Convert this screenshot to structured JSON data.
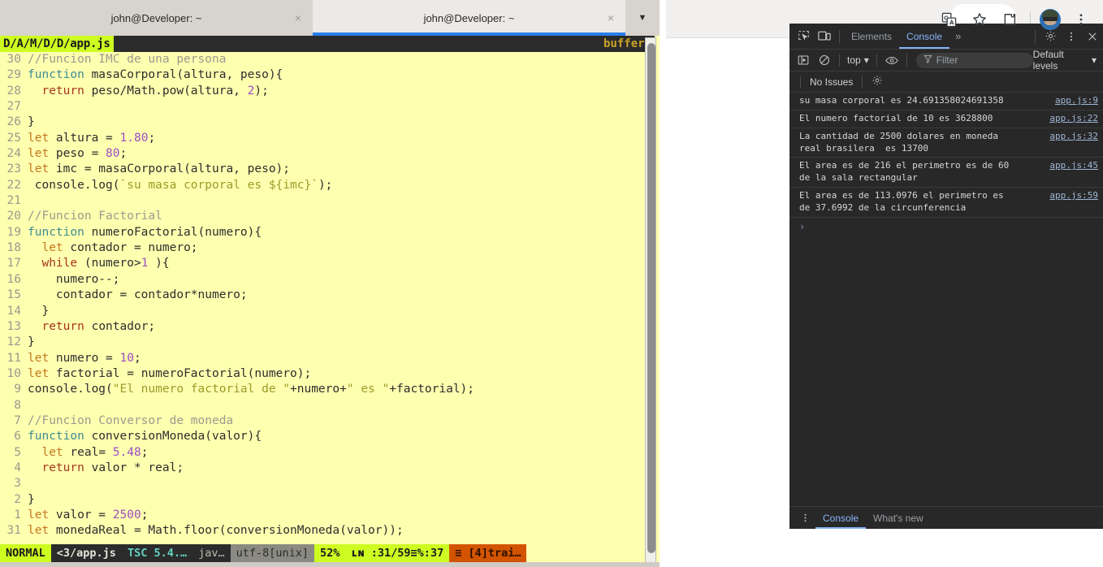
{
  "browser": {
    "toolbar": {
      "icons": [
        {
          "name": "translate-icon",
          "label": "Translate"
        },
        {
          "name": "bookmark-star-icon",
          "label": "Bookmark this tab"
        },
        {
          "name": "extensions-puzzle-icon",
          "label": "Extensions"
        },
        {
          "name": "profile-avatar",
          "label": "Profile"
        },
        {
          "name": "chrome-menu-kebab-icon",
          "label": "Customize and control Google Chrome"
        }
      ]
    }
  },
  "devtools": {
    "tabbar": {
      "inspect_icon": "inspect-element-icon",
      "device_icon": "device-toolbar-icon",
      "tabs": [
        {
          "label": "Elements",
          "active": false
        },
        {
          "label": "Console",
          "active": true
        }
      ],
      "more_label": "»",
      "settings_icon": "gear-icon",
      "kebab_icon": "more-options-icon",
      "close_icon": "close-icon"
    },
    "filterbar": {
      "sidebar_icon": "console-sidebar-icon",
      "clear_icon": "clear-console-icon",
      "context": "top",
      "eye_icon": "live-expression-eye-icon",
      "filter_icon": "filter-funnel-icon",
      "filter_placeholder": "Filter",
      "filter_value": "",
      "levels_label": "Default levels"
    },
    "issuebar": {
      "issues_label": "No Issues",
      "settings_icon": "console-settings-gear-icon"
    },
    "console_messages": [
      {
        "text": "su masa corporal es 24.691358024691358",
        "source": "app.js:9"
      },
      {
        "text": "El numero factorial de 10 es 3628800",
        "source": "app.js:22"
      },
      {
        "text": "La cantidad de 2500 dolares en moneda\nreal brasilera  es 13700",
        "source": "app.js:32"
      },
      {
        "text": "El area es de 216 el perimetro es de 60\nde la sala rectangular",
        "source": "app.js:45"
      },
      {
        "text": "El area es de 113.0976 el perimetro es\nde 37.6992 de la circunferencia",
        "source": "app.js:59"
      }
    ],
    "prompt_glyph": "›",
    "drawer": {
      "kebab_icon": "drawer-more-options-icon",
      "tabs": [
        {
          "label": "Console",
          "active": true
        },
        {
          "label": "What's new",
          "active": false
        }
      ]
    }
  },
  "terminal": {
    "tabs": [
      {
        "label": "john@Developer: ~",
        "active": false,
        "close_glyph": "×"
      },
      {
        "label": "john@Developer: ~",
        "active": true,
        "close_glyph": "×"
      }
    ],
    "tab_menu_glyph": "▼",
    "tmux": {
      "file_label": "D/A/M/D/D/app.js",
      "right_label": "buffers"
    },
    "code_lines": [
      {
        "num": "30",
        "tokens": [
          {
            "c": "k-cmt",
            "t": "//Funcion IMC de una persona"
          }
        ]
      },
      {
        "num": "29",
        "tokens": [
          {
            "c": "k-fn",
            "t": "function"
          },
          {
            "c": "k-id",
            "t": " masaCorporal(altura, peso){"
          }
        ]
      },
      {
        "num": "28",
        "tokens": [
          {
            "c": "k-id",
            "t": "  "
          },
          {
            "c": "k-ret",
            "t": "return"
          },
          {
            "c": "k-id",
            "t": " peso/Math.pow(altura, "
          },
          {
            "c": "k-num",
            "t": "2"
          },
          {
            "c": "k-id",
            "t": ");"
          }
        ]
      },
      {
        "num": "27",
        "tokens": []
      },
      {
        "num": "26",
        "tokens": [
          {
            "c": "k-id",
            "t": "}"
          }
        ]
      },
      {
        "num": "25",
        "tokens": [
          {
            "c": "k-kw",
            "t": "let"
          },
          {
            "c": "k-id",
            "t": " altura = "
          },
          {
            "c": "k-num",
            "t": "1.80"
          },
          {
            "c": "k-id",
            "t": ";"
          }
        ]
      },
      {
        "num": "24",
        "tokens": [
          {
            "c": "k-kw",
            "t": "let"
          },
          {
            "c": "k-id",
            "t": " peso = "
          },
          {
            "c": "k-num",
            "t": "80"
          },
          {
            "c": "k-id",
            "t": ";"
          }
        ]
      },
      {
        "num": "23",
        "tokens": [
          {
            "c": "k-kw",
            "t": "let"
          },
          {
            "c": "k-id",
            "t": " imc = masaCorporal(altura, peso);"
          }
        ]
      },
      {
        "num": "22",
        "tokens": [
          {
            "c": "k-id",
            "t": " console.log("
          },
          {
            "c": "k-str",
            "t": "`su masa corporal es ${imc}`"
          },
          {
            "c": "k-id",
            "t": ");"
          }
        ]
      },
      {
        "num": "21",
        "tokens": []
      },
      {
        "num": "20",
        "tokens": [
          {
            "c": "k-cmt",
            "t": "//Funcion Factorial"
          }
        ]
      },
      {
        "num": "19",
        "tokens": [
          {
            "c": "k-fn",
            "t": "function"
          },
          {
            "c": "k-id",
            "t": " numeroFactorial(numero){"
          }
        ]
      },
      {
        "num": "18",
        "tokens": [
          {
            "c": "k-id",
            "t": "  "
          },
          {
            "c": "k-kw",
            "t": "let"
          },
          {
            "c": "k-id",
            "t": " contador = numero;"
          }
        ]
      },
      {
        "num": "17",
        "tokens": [
          {
            "c": "k-id",
            "t": "  "
          },
          {
            "c": "k-ret",
            "t": "while"
          },
          {
            "c": "k-id",
            "t": " (numero>"
          },
          {
            "c": "k-num",
            "t": "1"
          },
          {
            "c": "k-id",
            "t": " ){"
          }
        ]
      },
      {
        "num": "16",
        "tokens": [
          {
            "c": "k-id",
            "t": "    numero--;"
          }
        ]
      },
      {
        "num": "15",
        "tokens": [
          {
            "c": "k-id",
            "t": "    contador = contador*numero;"
          }
        ]
      },
      {
        "num": "14",
        "tokens": [
          {
            "c": "k-id",
            "t": "  }"
          }
        ]
      },
      {
        "num": "13",
        "tokens": [
          {
            "c": "k-id",
            "t": "  "
          },
          {
            "c": "k-ret",
            "t": "return"
          },
          {
            "c": "k-id",
            "t": " contador;"
          }
        ]
      },
      {
        "num": "12",
        "tokens": [
          {
            "c": "k-id",
            "t": "}"
          }
        ]
      },
      {
        "num": "11",
        "tokens": [
          {
            "c": "k-kw",
            "t": "let"
          },
          {
            "c": "k-id",
            "t": " numero = "
          },
          {
            "c": "k-num",
            "t": "10"
          },
          {
            "c": "k-id",
            "t": ";"
          }
        ]
      },
      {
        "num": "10",
        "tokens": [
          {
            "c": "k-kw",
            "t": "let"
          },
          {
            "c": "k-id",
            "t": " factorial = numeroFactorial(numero);"
          }
        ]
      },
      {
        "num": "9",
        "tokens": [
          {
            "c": "k-id",
            "t": "console.log("
          },
          {
            "c": "k-str",
            "t": "\"El numero factorial de \""
          },
          {
            "c": "k-id",
            "t": "+numero+"
          },
          {
            "c": "k-str",
            "t": "\" es \""
          },
          {
            "c": "k-id",
            "t": "+factorial);"
          }
        ]
      },
      {
        "num": "8",
        "tokens": []
      },
      {
        "num": "7",
        "tokens": [
          {
            "c": "k-cmt",
            "t": "//Funcion Conversor de moneda"
          }
        ]
      },
      {
        "num": "6",
        "tokens": [
          {
            "c": "k-fn",
            "t": "function"
          },
          {
            "c": "k-id",
            "t": " conversionMoneda(valor){"
          }
        ]
      },
      {
        "num": "5",
        "tokens": [
          {
            "c": "k-id",
            "t": "  "
          },
          {
            "c": "k-kw",
            "t": "let"
          },
          {
            "c": "k-id",
            "t": " real= "
          },
          {
            "c": "k-num",
            "t": "5.48"
          },
          {
            "c": "k-id",
            "t": ";"
          }
        ]
      },
      {
        "num": "4",
        "tokens": [
          {
            "c": "k-id",
            "t": "  "
          },
          {
            "c": "k-ret",
            "t": "return"
          },
          {
            "c": "k-id",
            "t": " valor * real;"
          }
        ]
      },
      {
        "num": "3",
        "tokens": []
      },
      {
        "num": "2",
        "tokens": [
          {
            "c": "k-id",
            "t": "}"
          }
        ]
      },
      {
        "num": "1",
        "tokens": [
          {
            "c": "k-kw",
            "t": "let"
          },
          {
            "c": "k-id",
            "t": " valor = "
          },
          {
            "c": "k-num",
            "t": "2500"
          },
          {
            "c": "k-id",
            "t": ";"
          }
        ]
      },
      {
        "num": "31",
        "tokens": [
          {
            "c": "k-kw",
            "t": "let"
          },
          {
            "c": "k-id",
            "t": " monedaReal = Math.floor(conversionMoneda(valor));"
          }
        ]
      }
    ],
    "statusline": {
      "mode": "NORMAL",
      "file": "<3/app.js",
      "tsc": "TSC 5.4.…",
      "lang": "jav…",
      "encoding": "utf-8[unix]",
      "percent": "52%",
      "position": "ʟɴ :31/59≡%:37",
      "warnings": "≡ [4]trai…"
    }
  }
}
